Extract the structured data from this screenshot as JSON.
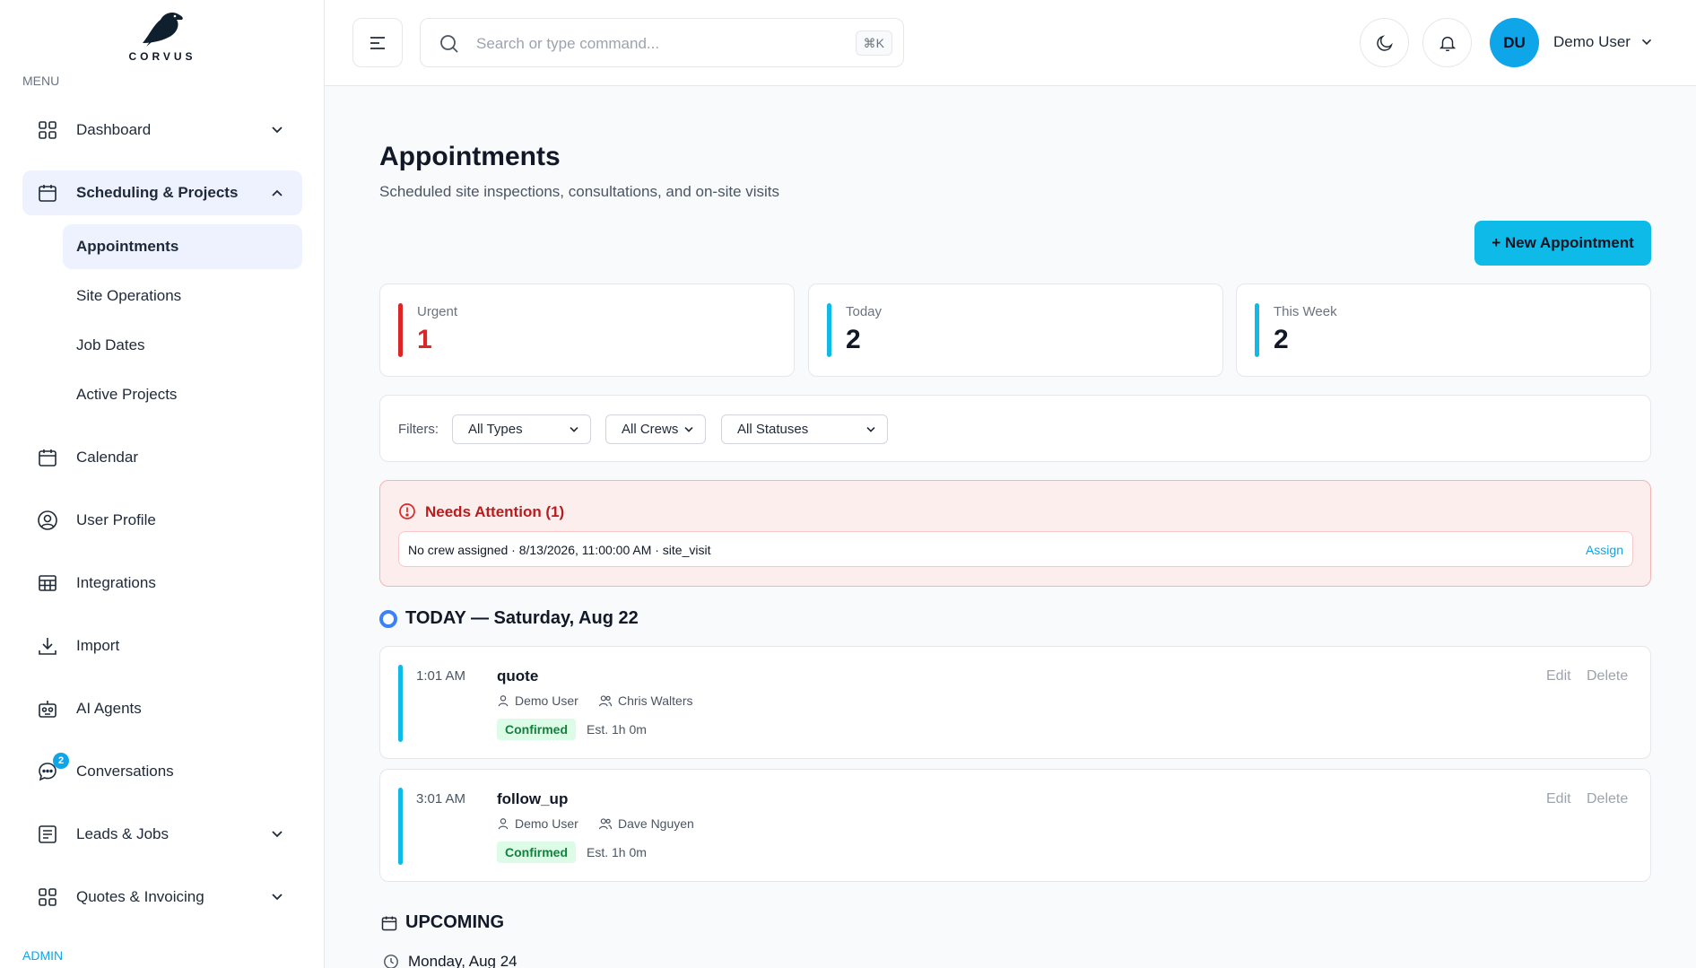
{
  "brand": {
    "name": "CORVUS"
  },
  "sidebar": {
    "menu_label": "MENU",
    "admin_label": "ADMIN",
    "items": [
      {
        "label": "Dashboard",
        "icon": "grid-icon"
      },
      {
        "label": "Scheduling & Projects",
        "icon": "calendar-icon"
      },
      {
        "label": "Calendar",
        "icon": "calendar-icon"
      },
      {
        "label": "User Profile",
        "icon": "user-circle-icon"
      },
      {
        "label": "Integrations",
        "icon": "table-icon"
      },
      {
        "label": "Import",
        "icon": "download-icon"
      },
      {
        "label": "AI Agents",
        "icon": "robot-icon"
      },
      {
        "label": "Conversations",
        "icon": "chat-icon",
        "badge": "2"
      },
      {
        "label": "Leads & Jobs",
        "icon": "list-icon"
      },
      {
        "label": "Quotes & Invoicing",
        "icon": "grid-icon"
      }
    ],
    "sub_items": [
      {
        "label": "Appointments"
      },
      {
        "label": "Site Operations"
      },
      {
        "label": "Job Dates"
      },
      {
        "label": "Active Projects"
      }
    ]
  },
  "header": {
    "search_placeholder": "Search or type command...",
    "shortcut": "⌘K",
    "user_initials": "DU",
    "user_name": "Demo User"
  },
  "page": {
    "title": "Appointments",
    "subtitle": "Scheduled site inspections, consultations, and on-site visits",
    "new_button": "+ New Appointment"
  },
  "stats": [
    {
      "label": "Urgent",
      "value": "1",
      "color": "#dc2626"
    },
    {
      "label": "Today",
      "value": "2",
      "color": "#0ebbe8"
    },
    {
      "label": "This Week",
      "value": "2",
      "color": "#0ebbe8"
    }
  ],
  "filters": {
    "label": "Filters:",
    "type": "All Types",
    "crew": "All Crews",
    "status": "All Statuses"
  },
  "attention": {
    "title": "Needs Attention (1)",
    "item_text": "No crew assigned · 8/13/2026, 11:00:00 AM · site_visit",
    "action": "Assign"
  },
  "today": {
    "heading": "TODAY — Saturday, Aug 22",
    "appointments": [
      {
        "time": "1:01 AM",
        "type": "quote",
        "user": "Demo User",
        "crew": "Chris Walters",
        "status": "Confirmed",
        "estimate": "Est. 1h 0m",
        "edit": "Edit",
        "delete": "Delete"
      },
      {
        "time": "3:01 AM",
        "type": "follow_up",
        "user": "Demo User",
        "crew": "Dave Nguyen",
        "status": "Confirmed",
        "estimate": "Est. 1h 0m",
        "edit": "Edit",
        "delete": "Delete"
      }
    ]
  },
  "upcoming": {
    "heading": "UPCOMING",
    "first_day": "Monday, Aug 24"
  },
  "colors": {
    "accent": "#0ebbe8",
    "urgent": "#dc2626",
    "active_nav": "#eef2ff"
  }
}
